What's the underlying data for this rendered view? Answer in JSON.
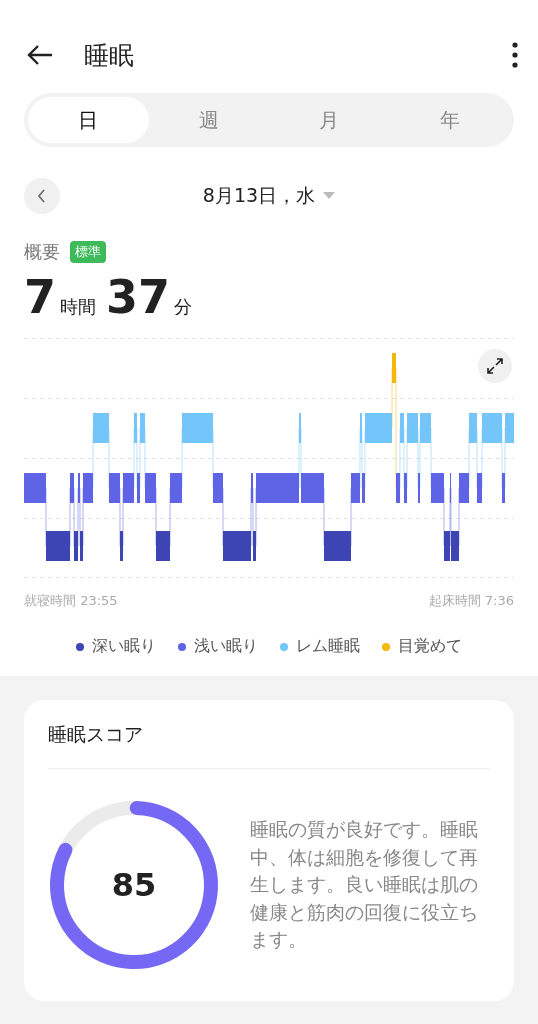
{
  "header": {
    "title": "睡眠"
  },
  "tabs": [
    {
      "label": "日",
      "selected": true
    },
    {
      "label": "週",
      "selected": false
    },
    {
      "label": "月",
      "selected": false
    },
    {
      "label": "年",
      "selected": false
    }
  ],
  "date": {
    "label": "8月13日，水"
  },
  "summary": {
    "title": "概要",
    "badge": "標準",
    "hours": "7",
    "hours_unit": "時間",
    "minutes": "37",
    "minutes_unit": "分"
  },
  "chart": {
    "start_label": "就寝時間 23:55",
    "end_label": "起床時間 7:36"
  },
  "legend": [
    {
      "label": "深い眠り",
      "color": "#3d44b3"
    },
    {
      "label": "浅い眠り",
      "color": "#5f63e6"
    },
    {
      "label": "レム睡眠",
      "color": "#74c6fa"
    },
    {
      "label": "目覚めて",
      "color": "#f5b70c"
    }
  ],
  "score_card": {
    "title": "睡眠スコア",
    "score": "85",
    "level": 0.85,
    "description": "睡眠の質が良好です。睡眠中、体は細胞を修復して再生します。良い睡眠は肌の健康と筋肉の回復に役立ちます。"
  }
}
